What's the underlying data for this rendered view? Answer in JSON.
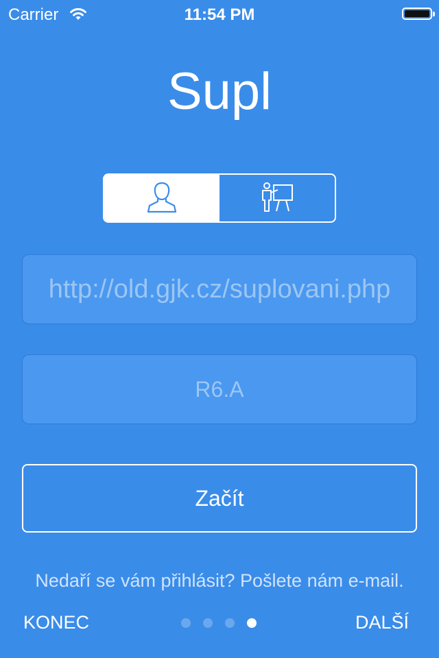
{
  "status_bar": {
    "carrier": "Carrier",
    "time": "11:54 PM"
  },
  "app": {
    "title": "Supl"
  },
  "role_selector": {
    "selected": "student",
    "options": [
      "student-icon",
      "teacher-icon"
    ]
  },
  "form": {
    "url_placeholder": "http://old.gjk.cz/suplovani.php",
    "class_placeholder": "R6.A",
    "start_label": "Začít"
  },
  "help_text": "Nedaří se vám přihlásit? Pošlete nám e-mail.",
  "nav": {
    "left_label": "KONEC",
    "right_label": "DALŠÍ",
    "page_count": 4,
    "current_page": 4
  },
  "colors": {
    "background": "#3a8ce9",
    "field_background": "#4a98f0",
    "accent": "#3a8ce9"
  }
}
